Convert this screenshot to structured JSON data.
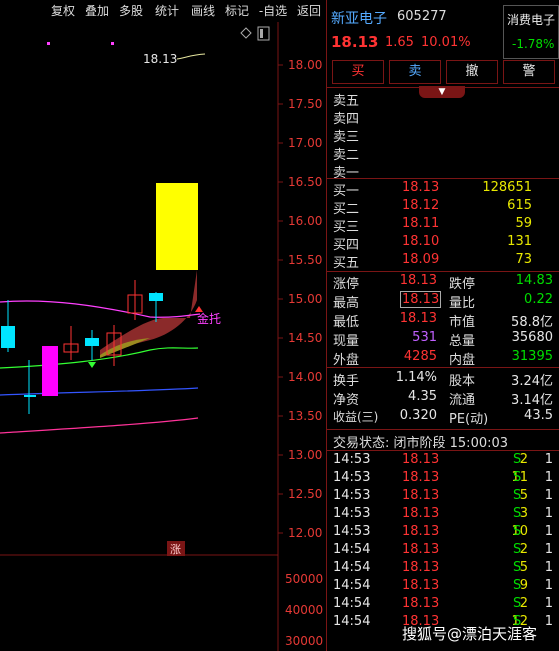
{
  "toolbar": {
    "buttons": [
      "复权",
      "叠加",
      "多股",
      "统计",
      "画线",
      "标记",
      "-自选",
      "返回"
    ]
  },
  "chart": {
    "price_ticks": [
      "18.00",
      "17.50",
      "17.00",
      "16.50",
      "16.00",
      "15.50",
      "15.00",
      "14.50",
      "14.00",
      "13.50",
      "13.00",
      "12.50",
      "12.00"
    ],
    "vol_ticks": [
      "50000",
      "40000",
      "30000"
    ],
    "last_price_label": "18.13",
    "signal_label": "金托",
    "limit_badge": "涨",
    "colors": {
      "up": "#ff3333",
      "down": "#00e5ff",
      "limit_up": "#ffff00",
      "ma1": "#ff40ff",
      "ma2": "#ff3333",
      "ma3": "#33ff33",
      "ma4": "#3355ff"
    }
  },
  "header": {
    "name": "新亚电子",
    "code": "605277",
    "sector": "消费电子",
    "sector_change": "-1.78%",
    "price": "18.13",
    "change": "1.65",
    "change_pct": "10.01%"
  },
  "actions": [
    "买",
    "卖",
    "撤",
    "警"
  ],
  "book": {
    "asks": [
      {
        "label": "卖五",
        "price": "",
        "vol": ""
      },
      {
        "label": "卖四",
        "price": "",
        "vol": ""
      },
      {
        "label": "卖三",
        "price": "",
        "vol": ""
      },
      {
        "label": "卖二",
        "price": "",
        "vol": ""
      },
      {
        "label": "卖一",
        "price": "",
        "vol": ""
      }
    ],
    "bids": [
      {
        "label": "买一",
        "price": "18.13",
        "vol": "128651"
      },
      {
        "label": "买二",
        "price": "18.12",
        "vol": "615"
      },
      {
        "label": "买三",
        "price": "18.11",
        "vol": "59"
      },
      {
        "label": "买四",
        "price": "18.10",
        "vol": "131"
      },
      {
        "label": "买五",
        "price": "18.09",
        "vol": "73"
      }
    ]
  },
  "stats": [
    {
      "l1": "涨停",
      "v1": "18.13",
      "c1": "red",
      "l2": "跌停",
      "v2": "14.83",
      "c2": "grn"
    },
    {
      "l1": "最高",
      "v1": "18.13",
      "c1": "red",
      "l2": "量比",
      "v2": "0.22",
      "c2": "grn"
    },
    {
      "l1": "最低",
      "v1": "18.13",
      "c1": "red",
      "l2": "市值",
      "v2": "58.8亿",
      "c2": "wht"
    },
    {
      "l1": "现量",
      "v1": "531",
      "c1": "pur",
      "l2": "总量",
      "v2": "35680",
      "c2": "wht"
    },
    {
      "l1": "外盘",
      "v1": "4285",
      "c1": "red",
      "l2": "内盘",
      "v2": "31395",
      "c2": "grn"
    }
  ],
  "fund": [
    {
      "l1": "换手",
      "v1": "1.14%",
      "l2": "股本",
      "v2": "3.24亿"
    },
    {
      "l1": "净资",
      "v1": "4.35",
      "l2": "流通",
      "v2": "3.14亿"
    },
    {
      "l1": "收益(三)",
      "v1": "0.320",
      "l2": "PE(动)",
      "v2": "43.5"
    }
  ],
  "trade_status": "交易状态: 闭市阶段 15:00:03",
  "ticks": [
    {
      "t": "14:53",
      "p": "18.13",
      "v": "2",
      "s": "S",
      "n": "1"
    },
    {
      "t": "14:53",
      "p": "18.13",
      "v": "11",
      "s": "S",
      "n": "1"
    },
    {
      "t": "14:53",
      "p": "18.13",
      "v": "5",
      "s": "S",
      "n": "1"
    },
    {
      "t": "14:53",
      "p": "18.13",
      "v": "3",
      "s": "S",
      "n": "1"
    },
    {
      "t": "14:53",
      "p": "18.13",
      "v": "10",
      "s": "S",
      "n": "1"
    },
    {
      "t": "14:54",
      "p": "18.13",
      "v": "2",
      "s": "S",
      "n": "1"
    },
    {
      "t": "14:54",
      "p": "18.13",
      "v": "5",
      "s": "S",
      "n": "1"
    },
    {
      "t": "14:54",
      "p": "18.13",
      "v": "9",
      "s": "S",
      "n": "1"
    },
    {
      "t": "14:54",
      "p": "18.13",
      "v": "2",
      "s": "S",
      "n": "1"
    },
    {
      "t": "14:54",
      "p": "18.13",
      "v": "12",
      "s": "S",
      "n": "1"
    }
  ],
  "watermark": "搜狐号@漂泊天涯客"
}
